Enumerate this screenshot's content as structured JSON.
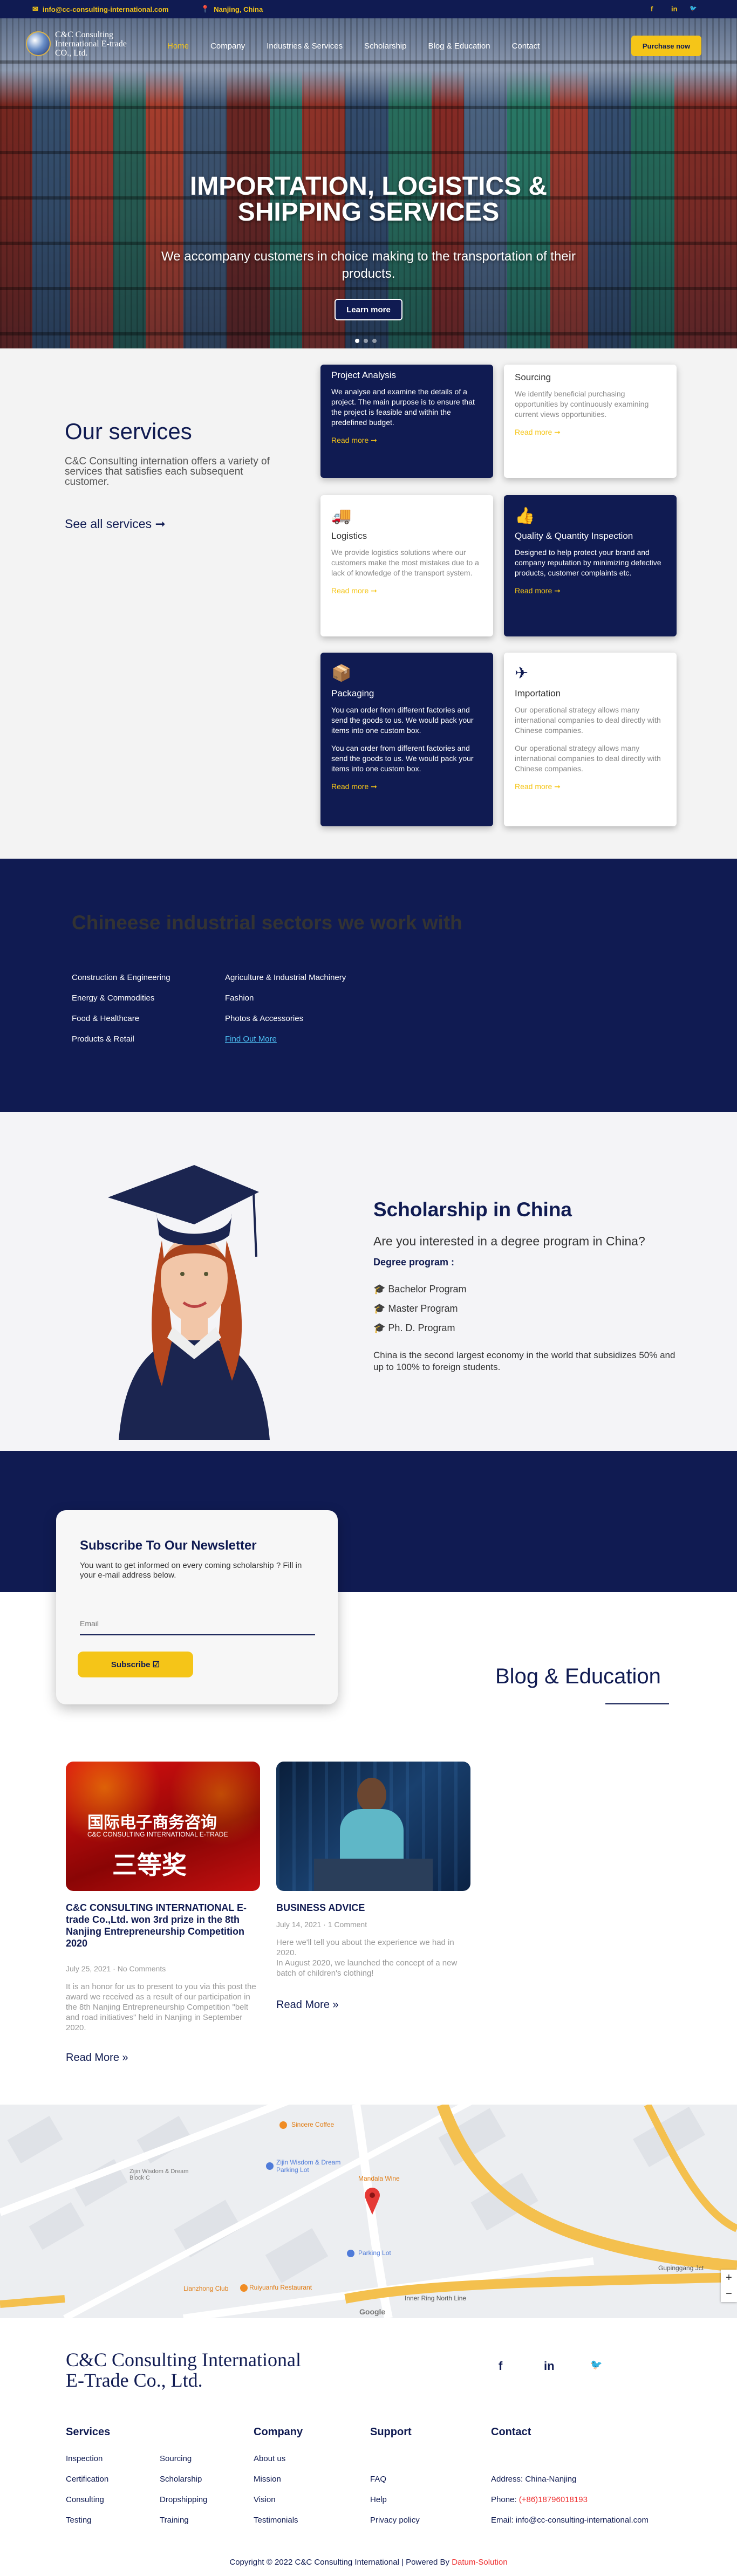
{
  "topbar": {
    "email": "info@cc-consulting-international.com",
    "location": "Nanjing, China",
    "social": [
      "f",
      "in",
      "🐦"
    ]
  },
  "brand": {
    "name_line1": "C&C Consulting",
    "name_line2": "International E-trade",
    "name_line3": "CO., Ltd."
  },
  "nav": {
    "items": [
      "Home",
      "Company",
      "Industries & Services",
      "Scholarship",
      "Blog & Education",
      "Contact"
    ],
    "active": "Home",
    "purchase_label": "Purchase now"
  },
  "hero": {
    "title_line1": "IMPORTATION, LOGISTICS &",
    "title_line2": "SHIPPING SERVICES",
    "subtitle_line1": "We accompany customers in choice making to the transportation of their",
    "subtitle_line2": "products.",
    "button": "Learn more",
    "slides": 3,
    "active_slide": 1
  },
  "services": {
    "title": "Our services",
    "description": "C&C Consulting internation offers a variety of services that satisfies each subsequent customer.",
    "see_all": "See all services ➞",
    "cards": [
      {
        "title": "Project Analysis",
        "text": "We analyse and examine the details of a project. The main purpose is to ensure that the project is feasible and within the predefined budget.",
        "more": "Read more ➞",
        "theme": "dark",
        "icon": "none"
      },
      {
        "title": "Sourcing",
        "text": "We identify beneficial purchasing opportunities by continuously examining current views opportunities.",
        "more": "Read more ➞",
        "theme": "light",
        "icon": "none"
      },
      {
        "title": "Logistics",
        "text": "We provide logistics solutions where our customers make the most mistakes due to a lack of knowledge of the transport system.",
        "more": "Read more ➞",
        "theme": "light",
        "icon": "truck-icon"
      },
      {
        "title": "Quality & Quantity Inspection",
        "text": "Designed to help protect your brand and company reputation by minimizing defective products, customer complaints etc.",
        "more": "Read more ➞",
        "theme": "dark",
        "icon": "thumbs-up-icon"
      },
      {
        "title": "Packaging",
        "text": "You can order from different factories and send the goods to us. We would pack your items into one custom box.",
        "text2": "You can order from different factories and send the goods to us. We would pack your items into one custom box.",
        "more": "Read more ➞",
        "theme": "dark",
        "icon": "box-icon"
      },
      {
        "title": "Importation",
        "text": "Our operational strategy allows many international companies to deal directly with Chinese companies.",
        "text2": "Our operational strategy allows many international companies to deal directly with Chinese companies.",
        "more": "Read more ➞",
        "theme": "light",
        "icon": "plane-icon"
      }
    ]
  },
  "sectors": {
    "title": "Chineese industrial sectors we work with",
    "col1": [
      "Construction & Engineering",
      "Energy & Commodities",
      "Food & Healthcare",
      "Products & Retail"
    ],
    "col2": [
      "Agriculture & Industrial Machinery",
      "Fashion",
      "Photos & Accessories",
      "Find Out More"
    ]
  },
  "scholarship": {
    "title": "Scholarship in China",
    "question": "Are you interested in a degree program in China?",
    "degree_label": "Degree program :",
    "programs": [
      "Bachelor Program",
      "Master Program",
      "Ph. D. Program"
    ],
    "note": "China is the second largest economy in the world that subsidizes 50% and up to 100% to foreign students."
  },
  "newsletter": {
    "title": "Subscribe To Our Newsletter",
    "text": "You want to get informed on every coming scholarship ? Fill in your e-mail address below.",
    "email_placeholder": "Email",
    "button": "Subscribe ☑"
  },
  "blog": {
    "title": "Blog & Education",
    "posts": [
      {
        "title": "C&C CONSULTING INTERNATIONAL E-trade Co.,Ltd. won 3rd prize in the 8th Nanjing Entrepreneurship Competition 2020",
        "date": "July 25, 2021",
        "comments": "No Comments",
        "excerpt": "It is an honor for us to present to you via this post the award we received as a result of our participation in the 8th Nanjing Entrepreneurship Competition \"belt and road initiatives\" held in Nanjing in September 2020.",
        "more": "Read More »",
        "image_text_cn": "国际电子商务咨询",
        "image_text_en": "C&C CONSULTING INTERNATIONAL E-TRADE",
        "image_award": "三等奖"
      },
      {
        "title": "BUSINESS ADVICE",
        "date": "July 14, 2021",
        "comments": "1 Comment",
        "excerpt": "Here we'll tell you about the experience we had in 2020.\nIn August 2020, we launched the concept of a new batch of children's clothing!",
        "more": "Read More »"
      }
    ]
  },
  "map": {
    "labels": [
      "Sincere Coffee",
      "Zijin Wisdom & Dream Parking Lot",
      "Zijin Wisdom & Dream Block C",
      "Mandala Wine",
      "Parking Lot",
      "Lianzhong Club",
      "Ruiyuanfu Restaurant",
      "Gupinggang Jct",
      "Inner Ring North Line",
      "Google"
    ],
    "zoom_in": "+",
    "zoom_out": "−"
  },
  "footer": {
    "brand_line1": "C&C Consulting International",
    "brand_line2": "E-Trade Co., Ltd.",
    "social": [
      "f",
      "in",
      "🐦"
    ],
    "services_title": "Services",
    "services_col1": [
      "Inspection",
      "Certification",
      "Consulting",
      "Testing"
    ],
    "services_col2": [
      "Sourcing",
      "Scholarship",
      "Dropshipping",
      "Training"
    ],
    "company_title": "Company",
    "company": [
      "About us",
      "Mission",
      "Vision",
      "Testimonials"
    ],
    "support_title": "Support",
    "support": [
      "FAQ",
      "Help",
      "Privacy policy"
    ],
    "contact_title": "Contact",
    "address": "Address: China-Nanjing",
    "phone_label": "Phone:",
    "phone": "(+86)18796018193",
    "email": "Email: info@cc-consulting-international.com",
    "copyright": "Copyright © 2022 C&C Consulting International | Powered By",
    "powered_by": "Datum-Solution"
  },
  "colors": {
    "navy": "#101b52",
    "yellow": "#f5c518",
    "accent_red": "#e33"
  }
}
